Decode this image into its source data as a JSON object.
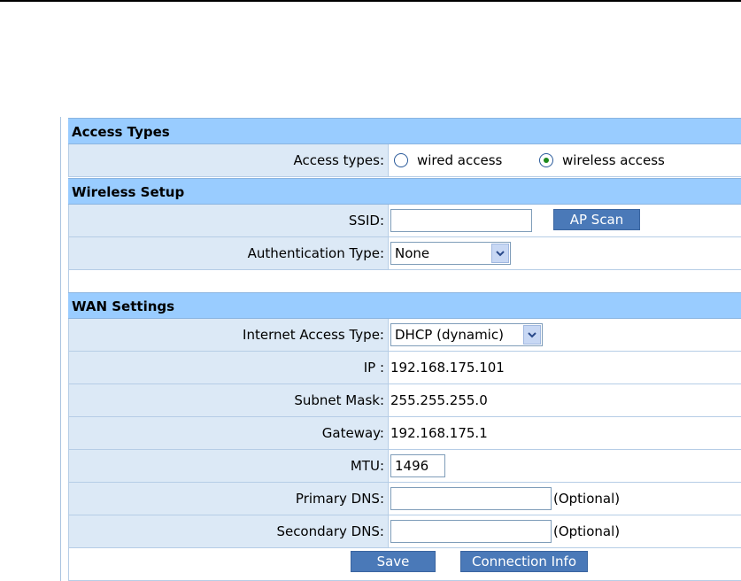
{
  "access_types": {
    "header": "Access Types",
    "label": "Access types:",
    "option_wired": "wired access",
    "option_wireless": "wireless access",
    "selected": "wireless access"
  },
  "wireless_setup": {
    "header": "Wireless Setup",
    "ssid_label": "SSID:",
    "ssid_value": "",
    "ap_scan_button": "AP Scan",
    "auth_label": "Authentication Type:",
    "auth_value": "None"
  },
  "wan_settings": {
    "header": "WAN Settings",
    "internet_access_label": "Internet Access Type:",
    "internet_access_value": "DHCP (dynamic)",
    "ip_label": "IP :",
    "ip_value": "192.168.175.101",
    "subnet_label": "Subnet Mask:",
    "subnet_value": "255.255.255.0",
    "gateway_label": "Gateway:",
    "gateway_value": "192.168.175.1",
    "mtu_label": "MTU:",
    "mtu_value": "1496",
    "primary_dns_label": "Primary DNS:",
    "primary_dns_value": "",
    "secondary_dns_label": "Secondary DNS:",
    "secondary_dns_value": "",
    "optional_note": "(Optional)"
  },
  "actions": {
    "save_button": "Save",
    "connection_info_button": "Connection Info"
  },
  "colors": {
    "section_header_bg": "#99ccff",
    "label_cell_bg": "#dce9f6",
    "button_bg": "#4a79b8"
  }
}
